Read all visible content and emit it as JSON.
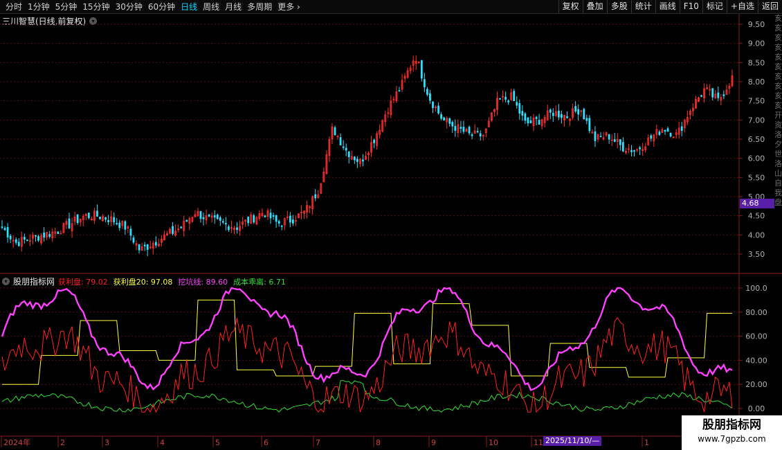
{
  "toolbar": {
    "tabs": [
      "分时",
      "1分钟",
      "5分钟",
      "15分钟",
      "30分钟",
      "60分钟",
      "日线",
      "周线",
      "月线",
      "多周期",
      "更多"
    ],
    "active_tab": "日线",
    "tools": [
      "复权",
      "叠加",
      "多股",
      "统计",
      "画线",
      "F10",
      "标记",
      "+自选",
      "返回"
    ]
  },
  "main_chart": {
    "title": "三川智慧(日线,前复权)",
    "current_price": "4.68",
    "price_axis": [
      "9.50",
      "9.00",
      "8.50",
      "8.00",
      "7.50",
      "7.00",
      "6.50",
      "6.00",
      "5.50",
      "5.00",
      "4.50",
      "4.00",
      "3.50"
    ]
  },
  "indicator": {
    "name": "股朋指标网",
    "lines": [
      {
        "label": "获利盘: 79.02",
        "color": "#ff2020"
      },
      {
        "label": "获利盘20: 97.08",
        "color": "#ffff40"
      },
      {
        "label": "挖坑线: 89.60",
        "color": "#ff40ff"
      },
      {
        "label": "成本乖离: 6.71",
        "color": "#30e030"
      }
    ],
    "axis": [
      "100.0",
      "80.00",
      "60.00",
      "40.00",
      "20.00",
      "0.00"
    ]
  },
  "time_axis": {
    "labels": [
      "2024年",
      "2",
      "3",
      "4",
      "5",
      "6",
      "7",
      "8",
      "9",
      "10",
      "11",
      "1"
    ],
    "cursor_date": "2025/11/10/—"
  },
  "right_strip_chars": [
    "亥",
    "亥",
    "亥",
    "亥",
    "亥",
    "亥",
    "亥",
    "亥",
    "亥",
    "亥",
    "开",
    "资",
    "洛",
    "夕",
    "世",
    "洛",
    "山",
    "自",
    "我",
    "盘"
  ],
  "watermark": {
    "title": "股朋指标网",
    "url": "www.7gpzb.com"
  },
  "chart_data": [
    {
      "type": "candlestick",
      "title": "三川智慧(日线,前复权)",
      "ylim": [
        3.2,
        9.6
      ],
      "y_ticks": [
        3.5,
        4.0,
        4.5,
        5.0,
        5.5,
        6.0,
        6.5,
        7.0,
        7.5,
        8.0,
        8.5,
        9.0,
        9.5
      ],
      "close_approx": [
        4.2,
        3.8,
        3.9,
        4.0,
        4.1,
        4.3,
        4.5,
        4.5,
        4.4,
        4.2,
        3.6,
        3.8,
        4.0,
        4.2,
        4.6,
        4.4,
        4.3,
        4.2,
        4.4,
        4.6,
        4.3,
        4.4,
        4.6,
        5.2,
        6.8,
        6.2,
        5.9,
        6.5,
        7.3,
        7.9,
        8.7,
        7.6,
        7.0,
        6.8,
        6.6,
        6.6,
        7.5,
        7.6,
        6.9,
        7.0,
        7.2,
        7.1,
        7.3,
        6.5,
        6.6,
        6.3,
        6.2,
        6.5,
        6.8,
        6.6,
        7.3,
        7.8,
        7.5,
        8.1
      ]
    },
    {
      "type": "line",
      "series": [
        {
          "name": "获利盘",
          "color": "#ff2020",
          "last": 79.02
        },
        {
          "name": "获利盘20",
          "color": "#ffff40",
          "last": 97.08
        },
        {
          "name": "挖坑线",
          "color": "#ff40ff",
          "last": 89.6
        },
        {
          "name": "成本乖离",
          "color": "#30e030",
          "last": 6.71
        }
      ],
      "ylim": [
        -5,
        105
      ],
      "y_ticks": [
        0,
        20,
        40,
        60,
        80,
        100
      ]
    }
  ]
}
